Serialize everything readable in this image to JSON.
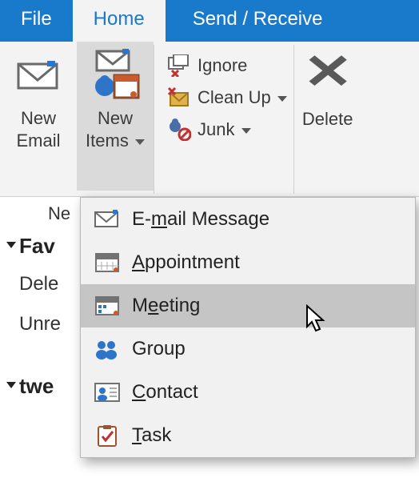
{
  "tabs": {
    "file": "File",
    "home": "Home",
    "sendreceive": "Send / Receive"
  },
  "ribbon": {
    "new_email_l1": "New",
    "new_email_l2": "Email",
    "new_items_l1": "New",
    "new_items_l2": "Items",
    "ignore": "Ignore",
    "cleanup": "Clean Up",
    "junk": "Junk",
    "delete": "Delete"
  },
  "nav": {
    "top_fragment": "Ne",
    "favorites_fragment": "Fav",
    "deleted_fragment": "Dele",
    "unread_fragment": "Unre",
    "account_fragment": "twe"
  },
  "menu": {
    "email_pre": "E-",
    "email_ul": "m",
    "email_post": "ail Message",
    "appt_ul": "A",
    "appt_post": "ppointment",
    "meeting_pre": "M",
    "meeting_ul": "e",
    "meeting_post": "eting",
    "group": "Group",
    "contact_ul": "C",
    "contact_post": "ontact",
    "task_ul": "T",
    "task_post": "ask"
  }
}
